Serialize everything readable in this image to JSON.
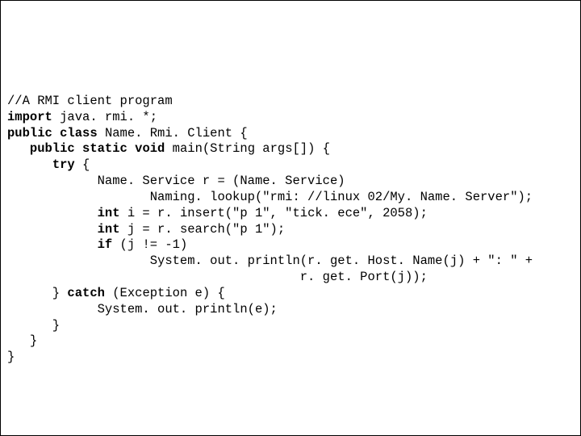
{
  "code": {
    "l01_a": "//A RMI client program",
    "l02_a": "import",
    "l02_b": " java. rmi. *;",
    "l03_a": "public",
    "l03_b": " ",
    "l03_c": "class",
    "l03_d": " Name. Rmi. Client {",
    "l04_a": "   ",
    "l04_b": "public",
    "l04_c": " ",
    "l04_d": "static",
    "l04_e": " ",
    "l04_f": "void",
    "l04_g": " main(String args[]) {",
    "l05_a": "      ",
    "l05_b": "try",
    "l05_c": " {",
    "l06_a": "            Name. Service r = (Name. Service)",
    "l07_a": "                   Naming. lookup(\"rmi: //linux 02/My. Name. Server\");",
    "l08_a": "            ",
    "l08_b": "int",
    "l08_c": " i = r. insert(\"p 1\", \"tick. ece\", 2058);",
    "l09_a": "            ",
    "l09_b": "int",
    "l09_c": " j = r. search(\"p 1\");",
    "l10_a": "            ",
    "l10_b": "if",
    "l10_c": " (j != -1)",
    "l11_a": "                   System. out. println(r. get. Host. Name(j) + \": \" +",
    "l12_a": "                                       r. get. Port(j));",
    "l13_a": "      } ",
    "l13_b": "catch",
    "l13_c": " (Exception e) {",
    "l14_a": "            System. out. println(e);",
    "l15_a": "      }",
    "l16_a": "   }",
    "l17_a": "}"
  }
}
